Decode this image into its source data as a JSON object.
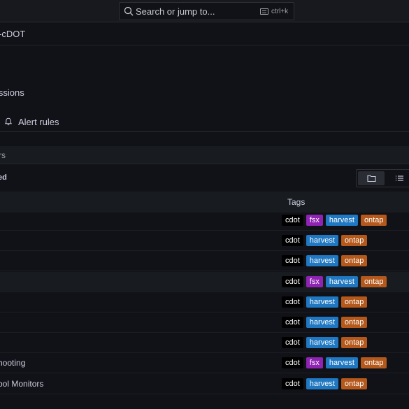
{
  "search": {
    "placeholder": "Search or jump to...",
    "shortcut": "ctrl+k"
  },
  "breadcrumb": "-cDOT",
  "permissions_label": "issions",
  "alert_tab": "Alert rules",
  "section_title": "rs",
  "filter_label": "ed",
  "table": {
    "tags_header": "Tags",
    "rows": [
      {
        "name": "",
        "tags": [
          "cdot",
          "fsx",
          "harvest",
          "ontap"
        ]
      },
      {
        "name": "",
        "tags": [
          "cdot",
          "harvest",
          "ontap"
        ]
      },
      {
        "name": "",
        "tags": [
          "cdot",
          "harvest",
          "ontap"
        ]
      },
      {
        "name": "",
        "tags": [
          "cdot",
          "fsx",
          "harvest",
          "ontap"
        ]
      },
      {
        "name": "",
        "tags": [
          "cdot",
          "harvest",
          "ontap"
        ]
      },
      {
        "name": "",
        "tags": [
          "cdot",
          "harvest",
          "ontap"
        ]
      },
      {
        "name": "",
        "tags": [
          "cdot",
          "harvest",
          "ontap"
        ]
      },
      {
        "name": "hooting",
        "tags": [
          "cdot",
          "fsx",
          "harvest",
          "ontap"
        ]
      },
      {
        "name": "ool Monitors",
        "tags": [
          "cdot",
          "harvest",
          "ontap"
        ]
      }
    ]
  },
  "tag_colors": {
    "cdot": "#000000",
    "fsx": "#8f23b3",
    "harvest": "#1f78c1",
    "ontap": "#b4581b"
  }
}
